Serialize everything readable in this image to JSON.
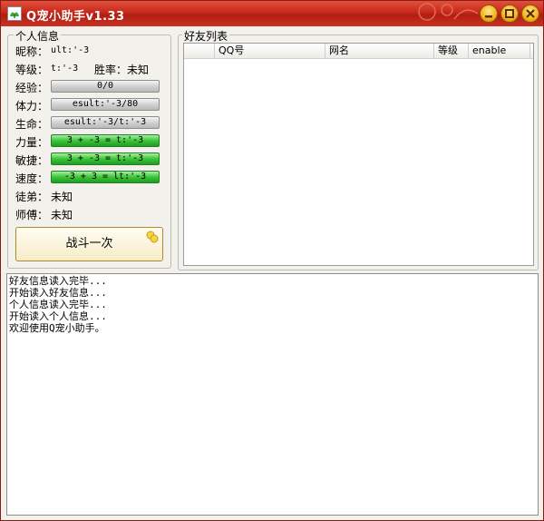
{
  "window": {
    "title": "Q宠小助手v1.33"
  },
  "info_panel": {
    "title": "个人信息",
    "nickname": {
      "label": "昵称：",
      "value": "ult:'-3"
    },
    "level": {
      "label": "等级：",
      "value": "t:'-3"
    },
    "winrate": {
      "label": "胜率：",
      "value": "未知"
    },
    "exp": {
      "label": "经验：",
      "value": "0/0"
    },
    "stamina": {
      "label": "体力：",
      "value": "esult:'-3/80"
    },
    "life": {
      "label": "生命：",
      "value": "esult:'-3/t:'-3"
    },
    "strength": {
      "label": "力量：",
      "value": "3 + -3 = t:'-3"
    },
    "agility": {
      "label": "敏捷：",
      "value": "3 + -3 = t:'-3"
    },
    "speed": {
      "label": "速度：",
      "value": "-3 + 3 = lt:'-3"
    },
    "apprentice": {
      "label": "徒弟：",
      "value": "未知"
    },
    "master": {
      "label": "师傅：",
      "value": "未知"
    },
    "fight_button": "战斗一次"
  },
  "friends_panel": {
    "title": "好友列表",
    "columns": [
      "QQ号",
      "网名",
      "等级",
      "enable"
    ],
    "rows": []
  },
  "log": {
    "lines": [
      "好友信息读入完毕...",
      "开始读入好友信息...",
      "个人信息读入完毕...",
      "开始读入个人信息...",
      "欢迎使用Q宠小助手。"
    ]
  },
  "colors": {
    "titlebar": "#c8281a",
    "bar_green": "#3cc43c",
    "bar_grey": "#cfcfcf"
  },
  "icons": [
    "app-icon",
    "minimize-icon",
    "maximize-icon",
    "close-icon",
    "coins-icon"
  ]
}
